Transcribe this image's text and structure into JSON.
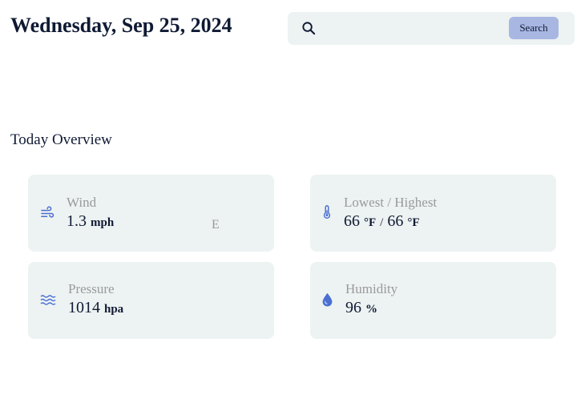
{
  "header": {
    "date": "Wednesday, Sep 25, 2024"
  },
  "search": {
    "placeholder": "",
    "value": "",
    "button_label": "Search",
    "icon": "search-icon"
  },
  "overview": {
    "title": "Today Overview",
    "wind": {
      "label": "Wind",
      "value": "1.3",
      "unit": "mph",
      "direction": "E",
      "icon": "wind-icon"
    },
    "temperature": {
      "label": "Lowest / Highest",
      "low": "66",
      "low_unit": "°F",
      "separator": "/",
      "high": "66",
      "high_unit": "°F",
      "icon": "thermometer-icon"
    },
    "pressure": {
      "label": "Pressure",
      "value": "1014",
      "unit": "hpa",
      "icon": "pressure-waves-icon"
    },
    "humidity": {
      "label": "Humidity",
      "value": "96",
      "unit": "%",
      "icon": "water-drop-icon"
    }
  },
  "colors": {
    "card_background": "#edf2f2",
    "icon_accent": "#4a6fd1",
    "button_background": "#a8b6e2",
    "text_primary": "#0f1a33",
    "text_muted": "#9a9a9a"
  }
}
